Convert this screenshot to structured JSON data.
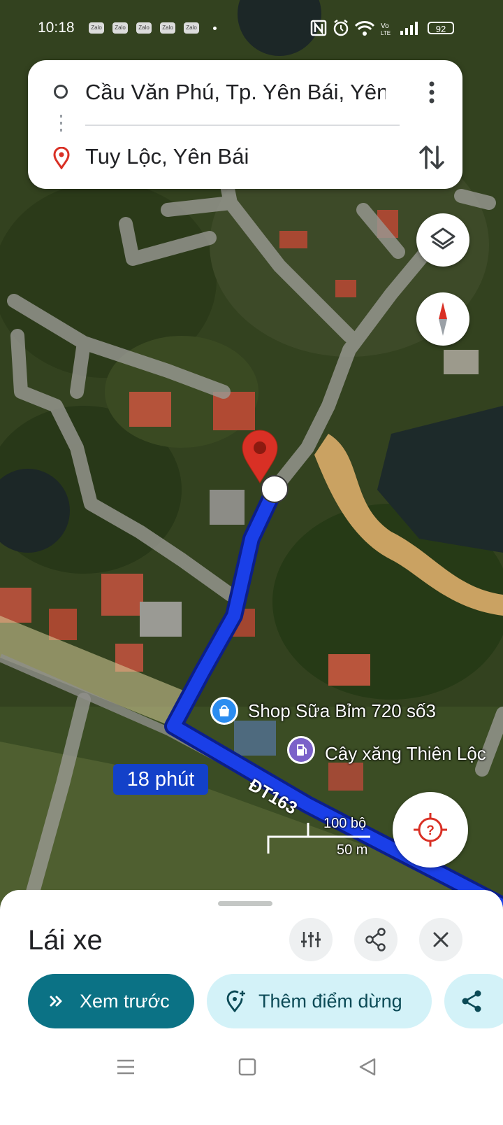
{
  "status_bar": {
    "time": "10:18",
    "notifications": [
      "Zalo",
      "Zalo",
      "Zalo",
      "Zalo",
      "Zalo"
    ],
    "battery": "92",
    "icons": [
      "nfc-icon",
      "alarm-icon",
      "wifi-icon",
      "volte-icon",
      "signal-icon"
    ]
  },
  "directions": {
    "origin": "Cầu Văn Phú, Tp. Yên Bái, Yên...",
    "destination": "Tuy Lộc, Yên Bái"
  },
  "map": {
    "route_time": "18 phút",
    "road_label": "ĐT163",
    "poi_shop": "Shop Sữa Bỉm 720 số3",
    "poi_gas": "Cây xăng Thiên Lộc",
    "scale_imperial": "100 bộ",
    "scale_metric": "50 m",
    "route_color": "#1a3fe8"
  },
  "sheet": {
    "title": "Lái xe",
    "preview_label": "Xem trước",
    "add_stop_label": "Thêm điểm dừng",
    "accent_color": "#0b7285"
  }
}
